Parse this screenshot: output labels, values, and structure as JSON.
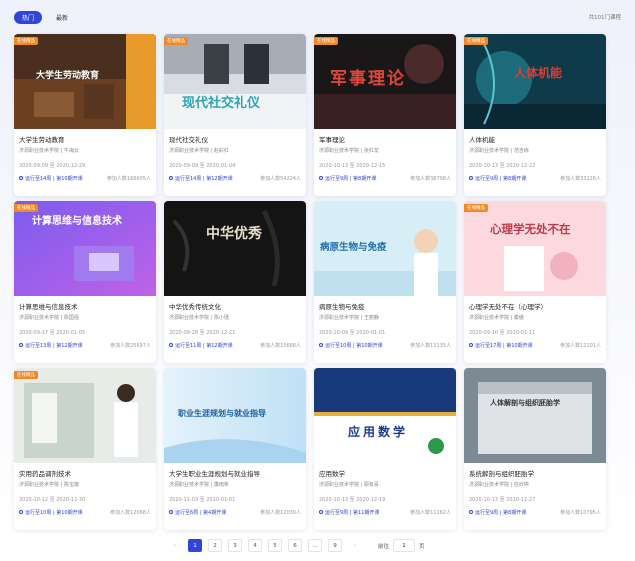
{
  "tabs": [
    {
      "label": "热门"
    },
    {
      "label": "最新"
    }
  ],
  "total_text": "共101门课程",
  "badge_label": "在线精品",
  "courses": [
    {
      "title": "大学生劳动教育",
      "school": "济源职业技术学院 | 牛海云",
      "dates": "2020-09-09 至 2020-12-29",
      "status": "运行至14周 | 第10期开课",
      "count": "参加人数166605人",
      "thumb_text": "大学生劳动教育"
    },
    {
      "title": "现代社交礼仪",
      "school": "济源职业技术学院 | 赵彩红",
      "dates": "2020-09-09 至 2020-01-04",
      "status": "运行至14周 | 第12期开课",
      "count": "参加人数54224人",
      "thumb_text": "现代社交礼仪"
    },
    {
      "title": "军事理论",
      "school": "济源职业技术学院 | 张红龙",
      "dates": "2020-10-13 至 2020-12-15",
      "status": "运行至9周 | 第8期开课",
      "count": "参加人数38798人",
      "thumb_text": "军事理论"
    },
    {
      "title": "人体机能",
      "school": "济源职业技术学院 | 范吉栋",
      "dates": "2020-10-13 至 2020-12-22",
      "status": "运行至9周 | 第8期开课",
      "count": "参加人数33228人",
      "thumb_text": "人体机能"
    },
    {
      "title": "计算思维与信息技术",
      "school": "济源职业技术学院 | 陈国强",
      "dates": "2020-09-17 至 2020-01-05",
      "status": "运行至13周 | 第12期开课",
      "count": "参加人数25697人",
      "thumb_text": "计算思维与信息技术"
    },
    {
      "title": "中华优秀传统文化",
      "school": "济源职业技术学院 | 陈小瑾",
      "dates": "2020-09-28 至 2020-12-21",
      "status": "运行至11周 | 第12期开课",
      "count": "参加人数15668人",
      "thumb_text": "中华优秀"
    },
    {
      "title": "病原生物与免疫",
      "school": "济源职业技术学院 | 王丽静",
      "dates": "2020-10-09 至 2020-01-01",
      "status": "运行至10周 | 第10期开课",
      "count": "参加人数13135人",
      "thumb_text": "病原生物与免疫"
    },
    {
      "title": "心理学无处不在（心理学）",
      "school": "济源职业技术学院 | 秦傲",
      "dates": "2020-09-10 至 2020-01-11",
      "status": "运行至17周 | 第10期开课",
      "count": "参加人数12101人",
      "thumb_text": "心理学无处不在"
    },
    {
      "title": "实用药品调剂技术",
      "school": "济源职业技术学院 | 陈宝旗",
      "dates": "2020-10-12 至 2020-12-30",
      "status": "运行至10周 | 第10期开课",
      "count": "参加人数12068人",
      "thumb_text": ""
    },
    {
      "title": "大学生职业生涯规划与就业指导",
      "school": "济源职业技术学院 | 廉雨希",
      "dates": "2020-11-03 至 2020-01-01",
      "status": "运行至6周 | 第4期开课",
      "count": "参加人数12030人",
      "thumb_text": "职业生涯规划与就业指导"
    },
    {
      "title": "应用数学",
      "school": "济源职业技术学院 | 顾有喜",
      "dates": "2020-10-13 至 2020-12-19",
      "status": "运行至9周 | 第11期开课",
      "count": "参加人数11162人",
      "thumb_text": "应用数学"
    },
    {
      "title": "系统解剖与组织胚胎学",
      "school": "济源职业技术学院 | 任欣婷",
      "dates": "2020-10-13 至 2020-12-27",
      "status": "运行至9周 | 第8期开课",
      "count": "参加人数10795人",
      "thumb_text": "人体解剖与组织胚胎学"
    }
  ],
  "pagination": {
    "prev": "‹",
    "pages": [
      "1",
      "2",
      "3",
      "4",
      "5",
      "6",
      "...",
      "9"
    ],
    "next": "›",
    "goto_label": "前往",
    "goto_value": "1",
    "page_unit": "页"
  }
}
